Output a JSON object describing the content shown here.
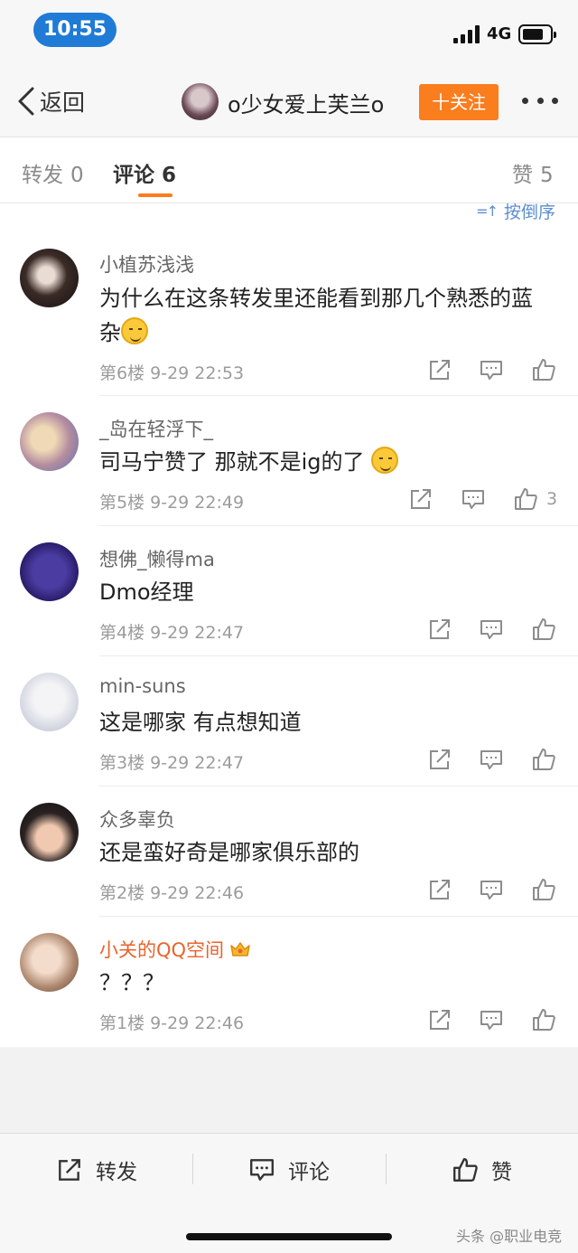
{
  "status_bar": {
    "time": "10:55",
    "network": "4G"
  },
  "nav": {
    "back_label": "返回",
    "title": "o少女爱上芙兰o",
    "follow_label": "十关注"
  },
  "tabs": [
    {
      "label": "转发",
      "count": "0"
    },
    {
      "label": "评论",
      "count": "6"
    },
    {
      "label": "赞",
      "count": "5"
    }
  ],
  "sort_label": "按倒序",
  "comments": [
    {
      "username": "小植苏浅浅",
      "text": "为什么在这条转发里还能看到那几个熟悉的蓝杂",
      "emoji": "smirk-emoji",
      "floor": "第6楼",
      "time": "9-29 22:53",
      "likes": ""
    },
    {
      "username": "_岛在轻浮下_",
      "text": "司马宁赞了 那就不是ig的了",
      "emoji": "yum-emoji",
      "floor": "第5楼",
      "time": "9-29 22:49",
      "likes": "3"
    },
    {
      "username": "想佛_懒得ma",
      "text": "Dmo经理",
      "floor": "第4楼",
      "time": "9-29 22:47",
      "likes": ""
    },
    {
      "username": "min-suns",
      "text": "这是哪家 有点想知道",
      "floor": "第3楼",
      "time": "9-29 22:47",
      "likes": ""
    },
    {
      "username": "众多辜负",
      "text": "还是蛮好奇是哪家俱乐部的",
      "floor": "第2楼",
      "time": "9-29 22:46",
      "likes": ""
    },
    {
      "username": "小关的QQ空间",
      "text": "？？？",
      "floor": "第1楼",
      "time": "9-29 22:46",
      "likes": "",
      "vip": true
    }
  ],
  "bottom_bar": {
    "repost_label": "转发",
    "comment_label": "评论",
    "like_label": "赞"
  },
  "watermark": "头条 @职业电竞",
  "colors": {
    "accent": "#fa7d1e",
    "link": "#5b8ed1",
    "time_pill": "#1f7bd6",
    "vip_name": "#e8642c"
  }
}
